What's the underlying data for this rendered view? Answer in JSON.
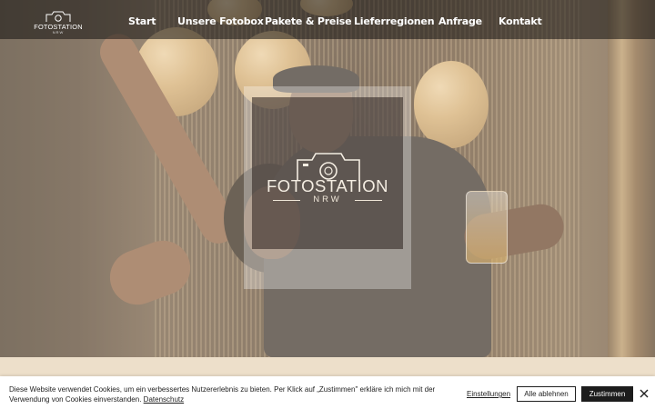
{
  "header": {
    "brand": {
      "name": "FOTOSTATION",
      "sub": "NRW"
    },
    "nav": [
      {
        "label": "Start"
      },
      {
        "label": "Unsere Fotobox"
      },
      {
        "label": "Pakete & Preise"
      },
      {
        "label": "Lieferregionen"
      },
      {
        "label": "Anfrage"
      },
      {
        "label": "Kontakt"
      }
    ]
  },
  "hero": {
    "logo": {
      "name": "FOTOSTATION",
      "sub": "NRW"
    }
  },
  "cookie_banner": {
    "text": "Diese Website verwendet Cookies, um ein verbessertes Nutzererlebnis zu bieten. Per Klick auf „Zustimmen\" erkläre ich mich mit der Verwendung von Cookies einverstanden.",
    "privacy_link": "Datenschutz",
    "settings_label": "Einstellungen",
    "reject_label": "Alle ablehnen",
    "accept_label": "Zustimmen"
  },
  "colors": {
    "header_bg": "#141211",
    "band_bg": "#eddfca",
    "accept_bg": "#1c1c1c"
  }
}
